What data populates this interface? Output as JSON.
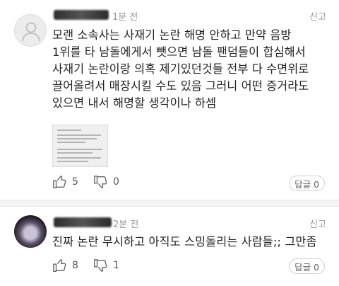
{
  "comments": [
    {
      "time": "1분 전",
      "report": "신고",
      "lines": [
        "모랜 소속사는 사재기 논란 해명 안하고 만약 음방",
        "1위를 타 남돌에게서 뺏으면 남돌 팬덤들이 합심해서",
        "사재기 논란이랑 의혹 제기있던것들 전부 다 수면위로",
        "끌어올려서 매장시킬 수도 있음 그러니 어떤 증거라도",
        "있으면 내서 해명할 생각이나 하셈"
      ],
      "likes": "5",
      "dislikes": "0",
      "reply": "답글 0"
    },
    {
      "time": "2분 전",
      "report": "신고",
      "lines": [
        "진짜 논란 무시하고 아직도 스밍돌리는 사람들;; 그만좀"
      ],
      "likes": "8",
      "dislikes": "1",
      "reply": "답글 0"
    }
  ],
  "icons": {
    "like": "thumbs-up-icon",
    "dislike": "thumbs-down-icon",
    "avatar_default": "user-silhouette-icon"
  },
  "colors": {
    "meta_text": "#9a9a9a",
    "body_text": "#222222",
    "separator": "#f4f4f4"
  }
}
